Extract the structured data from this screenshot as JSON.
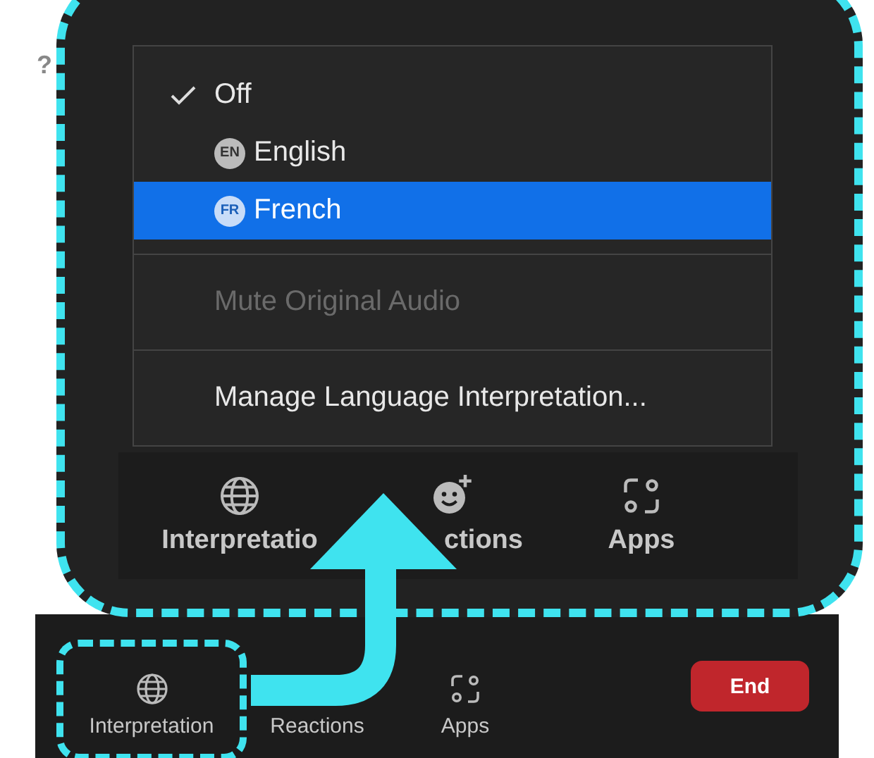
{
  "stray_mark": "?",
  "menu": {
    "options": [
      {
        "label": "Off",
        "checked": true,
        "selected": false
      },
      {
        "label": "English",
        "badge": "EN",
        "checked": false,
        "selected": false
      },
      {
        "label": "French",
        "badge": "FR",
        "checked": false,
        "selected": true
      }
    ],
    "actions": [
      {
        "label": "Mute Original Audio",
        "disabled": true
      },
      {
        "label": "Manage Language Interpretation...",
        "disabled": false
      }
    ]
  },
  "zoomed_toolbar": {
    "items": [
      {
        "kind": "globe",
        "label": "Interpretatio"
      },
      {
        "kind": "reactions",
        "label": "ctions"
      },
      {
        "kind": "apps",
        "label": "Apps"
      }
    ]
  },
  "toolbar": {
    "items": [
      {
        "kind": "globe",
        "label": "Interpretation",
        "highlighted": true
      },
      {
        "label": "Reactions",
        "highlighted": false
      },
      {
        "kind": "apps",
        "label": "Apps",
        "highlighted": false
      }
    ],
    "end_button": "End"
  }
}
